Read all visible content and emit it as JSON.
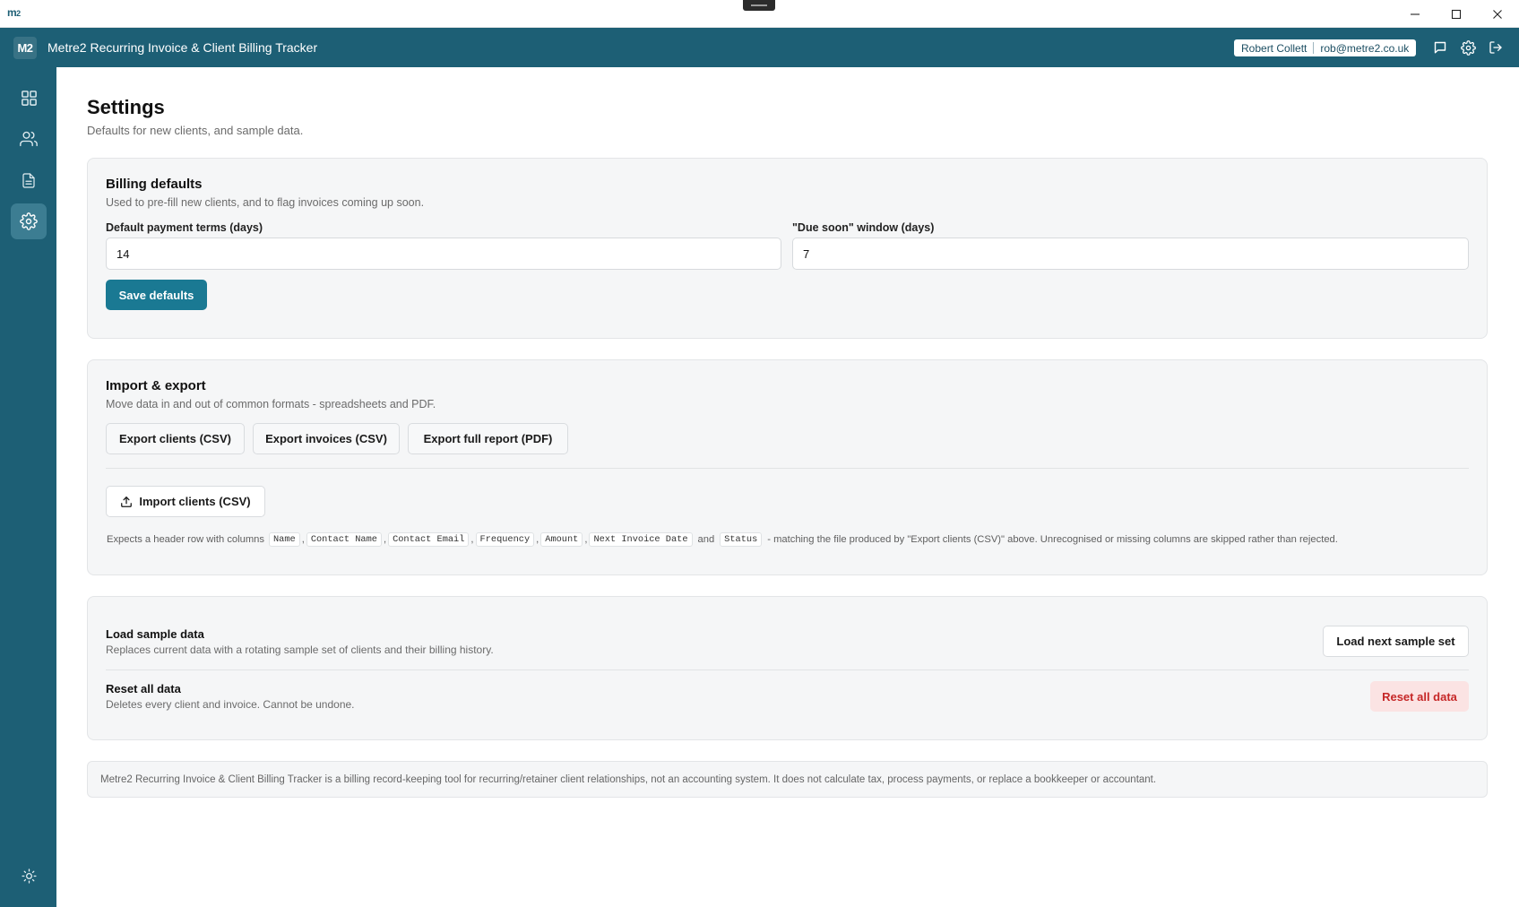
{
  "os": {
    "logo_main": "m",
    "logo_sub": "2"
  },
  "header": {
    "logo": "M2",
    "title": "Metre2 Recurring Invoice & Client Billing Tracker",
    "user_name": "Robert Collett",
    "user_email": "rob@metre2.co.uk"
  },
  "page": {
    "title": "Settings",
    "subtitle": "Defaults for new clients, and sample data."
  },
  "billing": {
    "title": "Billing defaults",
    "subtitle": "Used to pre-fill new clients, and to flag invoices coming up soon.",
    "terms_label": "Default payment terms (days)",
    "terms_value": "14",
    "due_label": "\"Due soon\" window (days)",
    "due_value": "7",
    "save_label": "Save defaults"
  },
  "import_export": {
    "title": "Import & export",
    "subtitle": "Move data in and out of common formats - spreadsheets and PDF.",
    "export_clients": "Export clients (CSV)",
    "export_invoices": "Export invoices (CSV)",
    "export_report": "Export full report (PDF)",
    "import_clients": "Import clients (CSV)",
    "help_prefix": "Expects a header row with columns",
    "columns": [
      "Name",
      "Contact Name",
      "Contact Email",
      "Frequency",
      "Amount",
      "Next Invoice Date",
      "Status"
    ],
    "comma": ",",
    "and_word": "and",
    "help_suffix": "- matching the file produced by \"Export clients (CSV)\" above. Unrecognised or missing columns are skipped rather than rejected."
  },
  "data": {
    "sample_title": "Load sample data",
    "sample_sub": "Replaces current data with a rotating sample set of clients and their billing history.",
    "sample_button": "Load next sample set",
    "reset_title": "Reset all data",
    "reset_sub": "Deletes every client and invoice. Cannot be undone.",
    "reset_button": "Reset all data"
  },
  "footer": {
    "note": "Metre2 Recurring Invoice & Client Billing Tracker is a billing record-keeping tool for recurring/retainer client relationships, not an accounting system. It does not calculate tax, process payments, or replace a bookkeeper or accountant."
  },
  "colors": {
    "brand": "#1d5f75",
    "primary_button": "#1a7993",
    "danger_text": "#c62828",
    "danger_bg": "#fbe3e3"
  },
  "icons": {
    "sidebar": [
      "dashboard-icon",
      "clients-icon",
      "invoices-icon",
      "settings-icon"
    ],
    "sidebar_bottom": "theme-sun-icon",
    "header": [
      "feedback-icon",
      "header-settings-icon",
      "logout-icon"
    ],
    "window": [
      "minimize-icon",
      "maximize-icon",
      "close-icon"
    ]
  }
}
